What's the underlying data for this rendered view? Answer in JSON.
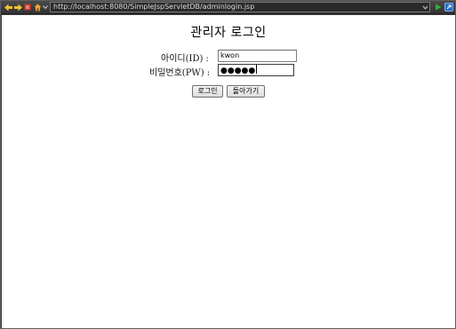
{
  "browser": {
    "url": "http://localhost:8080/SimpleJspServletDB/adminlogin.jsp",
    "icons": [
      "back-icon",
      "forward-icon",
      "stop-icon",
      "home-icon",
      "menu-chevron-icon",
      "url-dropdown-icon",
      "go-icon",
      "external-browser-icon"
    ]
  },
  "page": {
    "title": "관리자 로그인",
    "id_label": "아이디(ID) :",
    "id_value": "kwon",
    "pw_label": "비밀번호(PW) :",
    "pw_value_masked": "●●●●●",
    "login_button": "로그인",
    "back_button": "돌아가기"
  }
}
